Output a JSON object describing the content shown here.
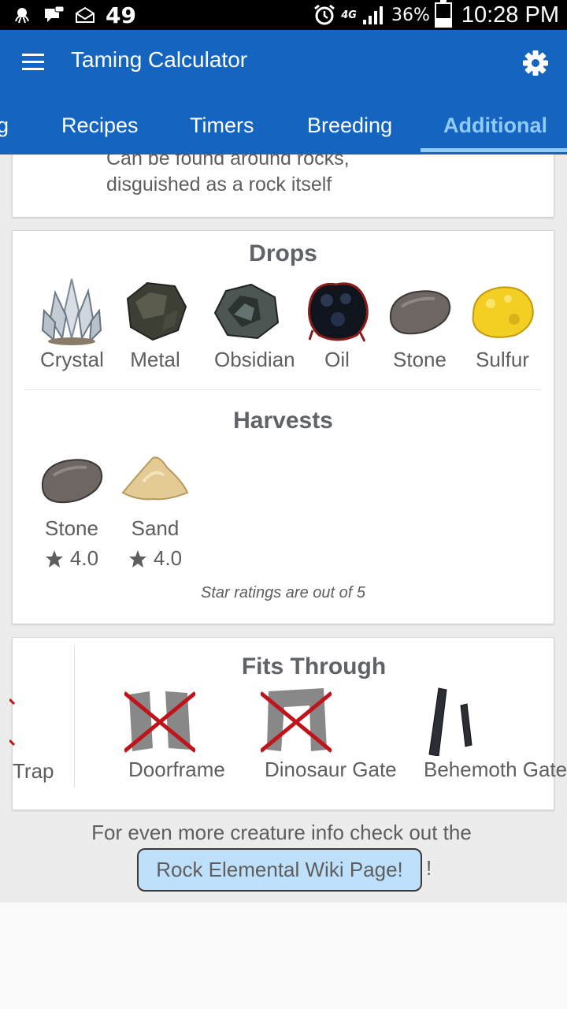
{
  "status_bar": {
    "notification_count": "49",
    "network": "4G",
    "battery": "36%",
    "battery_level": 0.36,
    "time": "10:28 PM"
  },
  "app_bar": {
    "title": "Taming Calculator",
    "menu_icon": "hamburger-menu-icon",
    "settings_icon": "gear-icon"
  },
  "tabs": [
    {
      "label": "g"
    },
    {
      "label": "Recipes"
    },
    {
      "label": "Timers"
    },
    {
      "label": "Breeding"
    },
    {
      "label": "Additional",
      "active": true
    }
  ],
  "description": {
    "line1": "Can be found around rocks,",
    "line2": "disguished as a rock itself"
  },
  "drops": {
    "title": "Drops",
    "items": [
      {
        "label": "Crystal"
      },
      {
        "label": "Metal"
      },
      {
        "label": "Obsidian"
      },
      {
        "label": "Oil"
      },
      {
        "label": "Stone"
      },
      {
        "label": "Sulfur"
      }
    ]
  },
  "harvests": {
    "title": "Harvests",
    "items": [
      {
        "label": "Stone",
        "rating": "4.0"
      },
      {
        "label": "Sand",
        "rating": "4.0"
      }
    ],
    "note": "Star ratings are out of 5"
  },
  "fits_through": {
    "title": "Fits Through",
    "left_item": "Trap",
    "items": [
      {
        "label": "Doorframe",
        "fits": false
      },
      {
        "label": "Dinosaur Gate",
        "fits": false
      },
      {
        "label": "Behemoth Gate",
        "fits": true
      }
    ]
  },
  "footer": {
    "text": "For even more creature info check out the",
    "link": "Rock Elemental Wiki Page!",
    "suffix": "!"
  },
  "colors": {
    "primary": "#1565c0",
    "tab_active": "#90caf9",
    "link_bg": "#bfe0fb",
    "cross": "#c0141c"
  }
}
